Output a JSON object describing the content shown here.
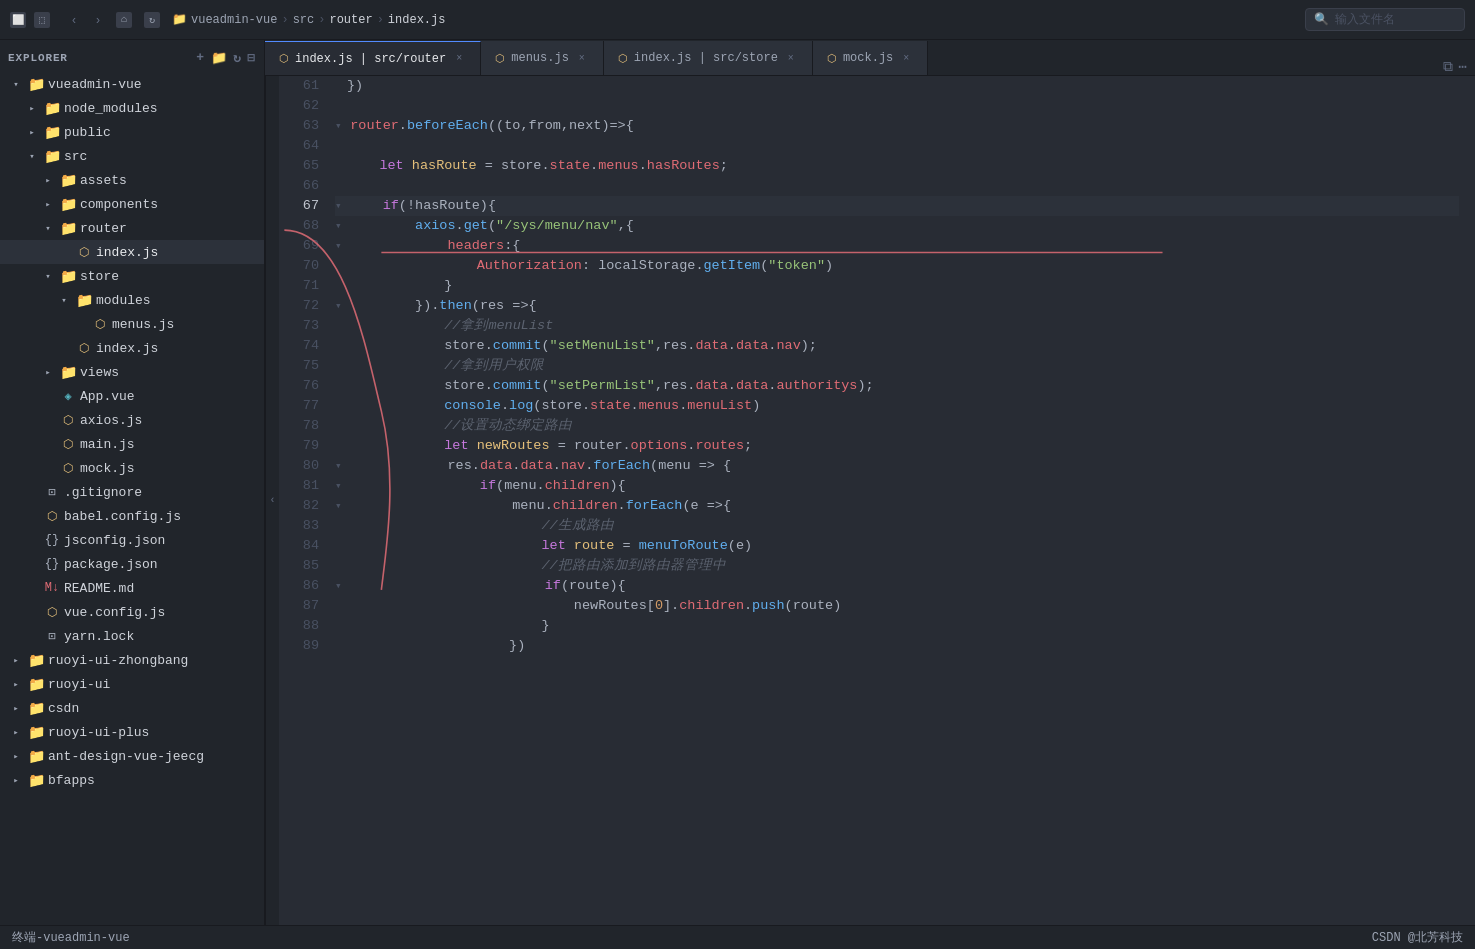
{
  "titlebar": {
    "breadcrumb": [
      "vueadmin-vue",
      "src",
      "router",
      "index.js"
    ],
    "search_placeholder": "输入文件名"
  },
  "sidebar": {
    "title": "vueadmin-vue",
    "items": [
      {
        "id": "vueadmin-vue",
        "label": "vueadmin-vue",
        "type": "root-folder",
        "indent": 0,
        "open": true
      },
      {
        "id": "node_modules",
        "label": "node_modules",
        "type": "folder",
        "indent": 1,
        "open": false
      },
      {
        "id": "public",
        "label": "public",
        "type": "folder",
        "indent": 1,
        "open": false
      },
      {
        "id": "src",
        "label": "src",
        "type": "folder",
        "indent": 1,
        "open": true
      },
      {
        "id": "assets",
        "label": "assets",
        "type": "folder",
        "indent": 2,
        "open": false
      },
      {
        "id": "components",
        "label": "components",
        "type": "folder",
        "indent": 2,
        "open": false
      },
      {
        "id": "router",
        "label": "router",
        "type": "folder",
        "indent": 2,
        "open": true
      },
      {
        "id": "router-index",
        "label": "index.js",
        "type": "file-js",
        "indent": 3,
        "active": true
      },
      {
        "id": "store",
        "label": "store",
        "type": "folder",
        "indent": 2,
        "open": true
      },
      {
        "id": "modules",
        "label": "modules",
        "type": "folder",
        "indent": 3,
        "open": true
      },
      {
        "id": "menus-js",
        "label": "menus.js",
        "type": "file-js",
        "indent": 4
      },
      {
        "id": "store-index",
        "label": "index.js",
        "type": "file-js",
        "indent": 3
      },
      {
        "id": "views",
        "label": "views",
        "type": "folder",
        "indent": 2,
        "open": false
      },
      {
        "id": "App-vue",
        "label": "App.vue",
        "type": "file-vue",
        "indent": 2
      },
      {
        "id": "axios-js",
        "label": "axios.js",
        "type": "file-js",
        "indent": 2
      },
      {
        "id": "main-js",
        "label": "main.js",
        "type": "file-js",
        "indent": 2
      },
      {
        "id": "mock-js",
        "label": "mock.js",
        "type": "file-js",
        "indent": 2
      },
      {
        "id": "gitignore",
        "label": ".gitignore",
        "type": "file-generic",
        "indent": 1
      },
      {
        "id": "babel-config",
        "label": "babel.config.js",
        "type": "file-js",
        "indent": 1
      },
      {
        "id": "jsconfig-json",
        "label": "jsconfig.json",
        "type": "file-json",
        "indent": 1
      },
      {
        "id": "package-json",
        "label": "package.json",
        "type": "file-json",
        "indent": 1
      },
      {
        "id": "README-md",
        "label": "README.md",
        "type": "file-md",
        "indent": 1
      },
      {
        "id": "vue-config",
        "label": "vue.config.js",
        "type": "file-js",
        "indent": 1
      },
      {
        "id": "yarn-lock",
        "label": "yarn.lock",
        "type": "file-generic",
        "indent": 1
      },
      {
        "id": "ruoyi-ui-zhongbang",
        "label": "ruoyi-ui-zhongbang",
        "type": "folder",
        "indent": 0,
        "open": false
      },
      {
        "id": "ruoyi-ui",
        "label": "ruoyi-ui",
        "type": "folder",
        "indent": 0,
        "open": false
      },
      {
        "id": "csdn",
        "label": "csdn",
        "type": "folder",
        "indent": 0,
        "open": false
      },
      {
        "id": "ruoyi-ui-plus",
        "label": "ruoyi-ui-plus",
        "type": "folder",
        "indent": 0,
        "open": false
      },
      {
        "id": "ant-design-vue-jeecg",
        "label": "ant-design-vue-jeecg",
        "type": "folder",
        "indent": 0,
        "open": false
      },
      {
        "id": "bfapps",
        "label": "bfapps",
        "type": "folder",
        "indent": 0,
        "open": false
      }
    ]
  },
  "tabs": [
    {
      "id": "tab-router-index",
      "label": "index.js | src/router",
      "active": true
    },
    {
      "id": "tab-menus",
      "label": "menus.js"
    },
    {
      "id": "tab-store-index",
      "label": "index.js | src/store"
    },
    {
      "id": "tab-mock",
      "label": "mock.js"
    }
  ],
  "code": {
    "lines": [
      {
        "num": 61,
        "content": "})"
      },
      {
        "num": 62,
        "content": ""
      },
      {
        "num": 63,
        "content": "router.beforeEach((to,from,next)=>{",
        "fold": true
      },
      {
        "num": 64,
        "content": ""
      },
      {
        "num": 65,
        "content": "    let hasRoute = store.state.menus.hasRoutes;"
      },
      {
        "num": 66,
        "content": ""
      },
      {
        "num": 67,
        "content": "    if(!hasRoute){",
        "fold": true,
        "active": true
      },
      {
        "num": 68,
        "content": "        axios.get(\"/sys/menu/nav\",{",
        "fold": true
      },
      {
        "num": 69,
        "content": "            headers:{",
        "fold": true
      },
      {
        "num": 70,
        "content": "                Authorization: localStorage.getItem(\"token\")"
      },
      {
        "num": 71,
        "content": "            }"
      },
      {
        "num": 72,
        "content": "        }).then(res =>{",
        "fold": true
      },
      {
        "num": 73,
        "content": "            //拿到menuList"
      },
      {
        "num": 74,
        "content": "            store.commit(\"setMenuList\",res.data.data.nav);"
      },
      {
        "num": 75,
        "content": "            //拿到用户权限"
      },
      {
        "num": 76,
        "content": "            store.commit(\"setPermList\",res.data.data.authoritys);"
      },
      {
        "num": 77,
        "content": "            console.log(store.state.menus.menuList)"
      },
      {
        "num": 78,
        "content": "            //设置动态绑定路由"
      },
      {
        "num": 79,
        "content": "            let newRoutes = router.options.routes;"
      },
      {
        "num": 80,
        "content": "            res.data.data.nav.forEach(menu => {",
        "fold": true
      },
      {
        "num": 81,
        "content": "                if(menu.children){",
        "fold": true
      },
      {
        "num": 82,
        "content": "                    menu.children.forEach(e =>{",
        "fold": true
      },
      {
        "num": 83,
        "content": "                        //生成路由"
      },
      {
        "num": 84,
        "content": "                        let route = menuToRoute(e)"
      },
      {
        "num": 85,
        "content": "                        //把路由添加到路由器管理中"
      },
      {
        "num": 86,
        "content": "                        if(route){",
        "fold": true
      },
      {
        "num": 87,
        "content": "                            newRoutes[0].children.push(route)"
      },
      {
        "num": 88,
        "content": "                        }"
      },
      {
        "num": 89,
        "content": "                    })"
      }
    ]
  },
  "statusbar": {
    "left": "终端-vueadmin-vue",
    "right": "CSDN @北芳科技"
  }
}
